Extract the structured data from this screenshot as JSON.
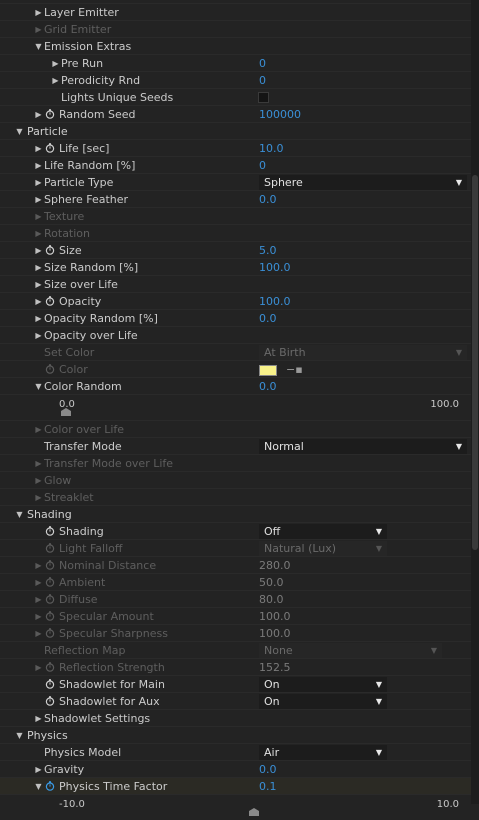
{
  "rows": [
    {
      "kind": "sub",
      "indent": 1,
      "label": "Layer Emitter",
      "disabled": false,
      "stopwatch": false
    },
    {
      "kind": "sub",
      "indent": 1,
      "label": "Grid Emitter",
      "disabled": true,
      "stopwatch": false
    },
    {
      "kind": "group",
      "indent": 1,
      "label": "Emission Extras",
      "disabled": false,
      "open": true
    },
    {
      "kind": "prop",
      "indent": 2,
      "label": "Pre Run",
      "value": "0",
      "disabled": false,
      "stopwatch": false
    },
    {
      "kind": "prop",
      "indent": 2,
      "label": "Perodicity Rnd",
      "value": "0",
      "disabled": false,
      "stopwatch": false
    },
    {
      "kind": "check",
      "indent": 2,
      "label": "Lights Unique Seeds",
      "disabled": false
    },
    {
      "kind": "prop",
      "indent": 1,
      "label": "Random Seed",
      "value": "100000",
      "disabled": false,
      "stopwatch": true
    },
    {
      "kind": "section",
      "indent": 0,
      "label": "Particle"
    },
    {
      "kind": "prop",
      "indent": 1,
      "label": "Life [sec]",
      "value": "10.0",
      "disabled": false,
      "stopwatch": true
    },
    {
      "kind": "prop",
      "indent": 1,
      "label": "Life Random [%]",
      "value": "0",
      "disabled": false,
      "stopwatch": false
    },
    {
      "kind": "dropdown",
      "indent": 1,
      "label": "Particle Type",
      "value": "Sphere",
      "disabled": false,
      "stopwatch": false,
      "wide": true
    },
    {
      "kind": "prop",
      "indent": 1,
      "label": "Sphere Feather",
      "value": "0.0",
      "disabled": false,
      "stopwatch": false
    },
    {
      "kind": "sub",
      "indent": 1,
      "label": "Texture",
      "disabled": true,
      "stopwatch": false
    },
    {
      "kind": "sub",
      "indent": 1,
      "label": "Rotation",
      "disabled": true,
      "stopwatch": false
    },
    {
      "kind": "prop",
      "indent": 1,
      "label": "Size",
      "value": "5.0",
      "disabled": false,
      "stopwatch": true
    },
    {
      "kind": "prop",
      "indent": 1,
      "label": "Size Random [%]",
      "value": "100.0",
      "disabled": false,
      "stopwatch": false
    },
    {
      "kind": "sub",
      "indent": 1,
      "label": "Size over Life",
      "disabled": false,
      "stopwatch": false
    },
    {
      "kind": "prop",
      "indent": 1,
      "label": "Opacity",
      "value": "100.0",
      "disabled": false,
      "stopwatch": true
    },
    {
      "kind": "prop",
      "indent": 1,
      "label": "Opacity Random [%]",
      "value": "0.0",
      "disabled": false,
      "stopwatch": false
    },
    {
      "kind": "sub",
      "indent": 1,
      "label": "Opacity over Life",
      "disabled": false,
      "stopwatch": false
    },
    {
      "kind": "dropdown",
      "indent": 1,
      "label": "Set Color",
      "value": "At Birth",
      "disabled": true,
      "stopwatch": false,
      "wide": true,
      "noTri": true
    },
    {
      "kind": "color",
      "indent": 1,
      "label": "Color",
      "disabled": true,
      "stopwatch": true
    },
    {
      "kind": "prop",
      "indent": 1,
      "label": "Color Random",
      "value": "0.0",
      "disabled": false,
      "stopwatch": false,
      "openTri": true
    },
    {
      "kind": "slider",
      "min": "0.0",
      "max": "100.0",
      "level": 0.0
    },
    {
      "kind": "sub",
      "indent": 1,
      "label": "Color over Life",
      "disabled": true,
      "stopwatch": false
    },
    {
      "kind": "dropdown",
      "indent": 1,
      "label": "Transfer Mode",
      "value": "Normal",
      "disabled": false,
      "stopwatch": false,
      "wide": true,
      "noTri": true
    },
    {
      "kind": "sub",
      "indent": 1,
      "label": "Transfer Mode over Life",
      "disabled": true,
      "stopwatch": false
    },
    {
      "kind": "sub",
      "indent": 1,
      "label": "Glow",
      "disabled": true,
      "stopwatch": false
    },
    {
      "kind": "sub",
      "indent": 1,
      "label": "Streaklet",
      "disabled": true,
      "stopwatch": false
    },
    {
      "kind": "section",
      "indent": 0,
      "label": "Shading"
    },
    {
      "kind": "dropdown",
      "indent": 1,
      "label": "Shading",
      "value": "Off",
      "disabled": false,
      "stopwatch": true,
      "wide": false,
      "noTri": true
    },
    {
      "kind": "dropdown",
      "indent": 1,
      "label": "Light Falloff",
      "value": "Natural (Lux)",
      "disabled": true,
      "stopwatch": true,
      "wide": false,
      "noTri": true
    },
    {
      "kind": "prop",
      "indent": 1,
      "label": "Nominal Distance",
      "value": "280.0",
      "disabled": true,
      "stopwatch": true
    },
    {
      "kind": "prop",
      "indent": 1,
      "label": "Ambient",
      "value": "50.0",
      "disabled": true,
      "stopwatch": true
    },
    {
      "kind": "prop",
      "indent": 1,
      "label": "Diffuse",
      "value": "80.0",
      "disabled": true,
      "stopwatch": true
    },
    {
      "kind": "prop",
      "indent": 1,
      "label": "Specular Amount",
      "value": "100.0",
      "disabled": true,
      "stopwatch": true
    },
    {
      "kind": "prop",
      "indent": 1,
      "label": "Specular Sharpness",
      "value": "100.0",
      "disabled": true,
      "stopwatch": true
    },
    {
      "kind": "dropdown",
      "indent": 1,
      "label": "Reflection Map",
      "value": "None",
      "disabled": true,
      "stopwatch": false,
      "wide": "mid",
      "noTri": true
    },
    {
      "kind": "prop",
      "indent": 1,
      "label": "Reflection Strength",
      "value": "152.5",
      "disabled": true,
      "stopwatch": true
    },
    {
      "kind": "dropdown",
      "indent": 1,
      "label": "Shadowlet for Main",
      "value": "On",
      "disabled": false,
      "stopwatch": true,
      "wide": false,
      "noTri": true
    },
    {
      "kind": "dropdown",
      "indent": 1,
      "label": "Shadowlet for Aux",
      "value": "On",
      "disabled": false,
      "stopwatch": true,
      "wide": false,
      "noTri": true
    },
    {
      "kind": "sub",
      "indent": 1,
      "label": "Shadowlet Settings",
      "disabled": false,
      "stopwatch": false
    },
    {
      "kind": "section",
      "indent": 0,
      "label": "Physics"
    },
    {
      "kind": "dropdown",
      "indent": 1,
      "label": "Physics Model",
      "value": "Air",
      "disabled": false,
      "stopwatch": false,
      "wide": false,
      "noTri": true
    },
    {
      "kind": "prop",
      "indent": 1,
      "label": "Gravity",
      "value": "0.0",
      "disabled": false,
      "stopwatch": false
    },
    {
      "kind": "prop",
      "indent": 1,
      "label": "Physics Time Factor",
      "value": "0.1",
      "disabled": false,
      "stopwatch": true,
      "openTri": true,
      "highlight": true,
      "activeStopwatch": true
    },
    {
      "kind": "slider",
      "min": "-10.0",
      "max": "10.0",
      "level": 0.5
    }
  ]
}
